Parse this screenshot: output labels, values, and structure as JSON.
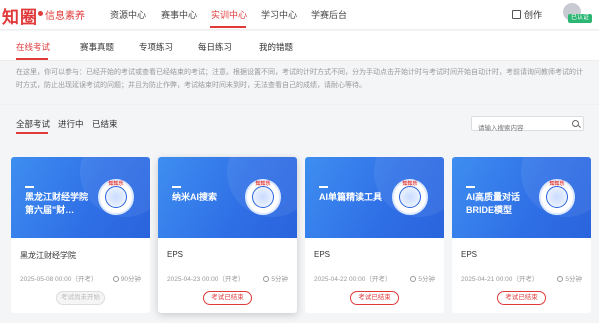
{
  "brand": {
    "logo": "知圈",
    "subtitle": "信息素养"
  },
  "nav": {
    "items": [
      {
        "label": "资源中心"
      },
      {
        "label": "赛事中心"
      },
      {
        "label": "实训中心"
      },
      {
        "label": "学习中心"
      },
      {
        "label": "学赛后台"
      }
    ],
    "create_label": "创作",
    "login_badge": "已认证"
  },
  "tabs": [
    {
      "label": "在线考试"
    },
    {
      "label": "赛事真题"
    },
    {
      "label": "专项练习"
    },
    {
      "label": "每日练习"
    },
    {
      "label": "我的错题"
    }
  ],
  "notice": "在这里，你可以参与：已经开始的考试或查看已经结束的考试；注意。根据设置不同，考试的计时方式不同，分为手动点击开始计时与考试时间开始自动计时，考前请询问教师考试的计时方式，防止出现延误考试的问题；并且为防止作弊，考试结束时间未到时，无法查看自己的成绩，请耐心等待。",
  "filters": [
    {
      "label": "全部考试"
    },
    {
      "label": "进行中"
    },
    {
      "label": "已结束"
    }
  ],
  "search": {
    "placeholder": "请输入搜索内容"
  },
  "seal_text": "知知乐",
  "cards": [
    {
      "title": "黑龙江财经学院第六届\"财…",
      "org": "黑龙江财经学院",
      "date": "2025-05-08 00:00（开考）",
      "duration": "90分钟",
      "button": "考试尚未开始"
    },
    {
      "title": "纳米AI搜索",
      "org": "EPS",
      "date": "2025-04-23 00:00（开考）",
      "duration": "5分钟",
      "button": "考试已结束"
    },
    {
      "title": "AI单篇精读工具",
      "org": "EPS",
      "date": "2025-04-22 00:00（开考）",
      "duration": "5分钟",
      "button": "考试已结束"
    },
    {
      "title": "AI高质量对话BRIDE模型",
      "org": "EPS",
      "date": "2025-04-21 00:00（开考）",
      "duration": "5分钟",
      "button": "考试已结束"
    }
  ],
  "colors": {
    "accent": "#e03a3a",
    "banner": "#2f6fe6",
    "badge": "#2bb673"
  }
}
